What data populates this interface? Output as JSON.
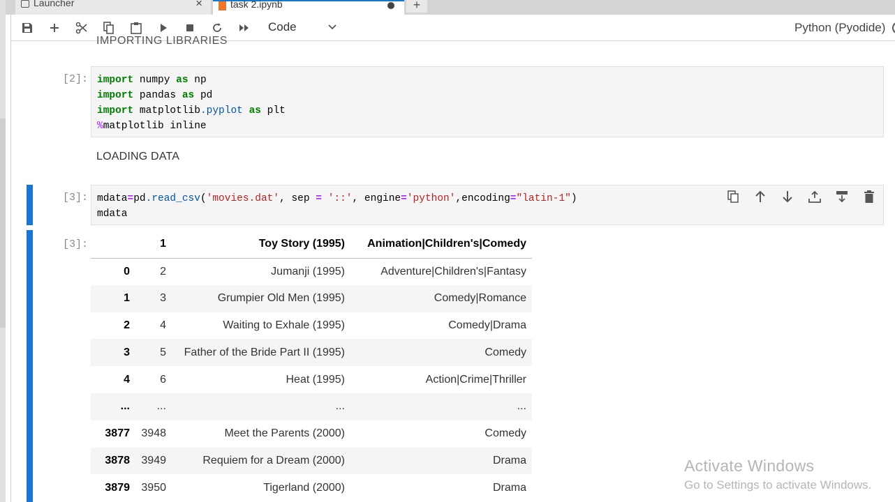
{
  "tabs": {
    "launcher_label": "Launcher",
    "notebook_label": "task 2.ipynb"
  },
  "toolbar": {
    "cell_type": "Code",
    "kernel_name": "Python (Pyodide)"
  },
  "cells": {
    "heading_partial": "IMPORTING LIBRARIES",
    "cell2_prompt": "[2]:",
    "md_loading": "LOADING DATA",
    "cell3_prompt": "[3]:",
    "out3_prompt": "[3]:"
  },
  "dataframe": {
    "columns": [
      "",
      "1",
      "Toy Story (1995)",
      "Animation|Children's|Comedy"
    ],
    "rows": [
      [
        "0",
        "2",
        "Jumanji (1995)",
        "Adventure|Children's|Fantasy"
      ],
      [
        "1",
        "3",
        "Grumpier Old Men (1995)",
        "Comedy|Romance"
      ],
      [
        "2",
        "4",
        "Waiting to Exhale (1995)",
        "Comedy|Drama"
      ],
      [
        "3",
        "5",
        "Father of the Bride Part II (1995)",
        "Comedy"
      ],
      [
        "4",
        "6",
        "Heat (1995)",
        "Action|Crime|Thriller"
      ],
      [
        "...",
        "...",
        "...",
        "..."
      ],
      [
        "3877",
        "3948",
        "Meet the Parents (2000)",
        "Comedy"
      ],
      [
        "3878",
        "3949",
        "Requiem for a Dream (2000)",
        "Drama"
      ],
      [
        "3879",
        "3950",
        "Tigerland (2000)",
        "Drama"
      ]
    ]
  },
  "watermark": {
    "line1": "Activate Windows",
    "line2": "Go to Settings to activate Windows."
  },
  "colors": {
    "accent": "#1976d2",
    "notebook_icon": "#f37626"
  }
}
